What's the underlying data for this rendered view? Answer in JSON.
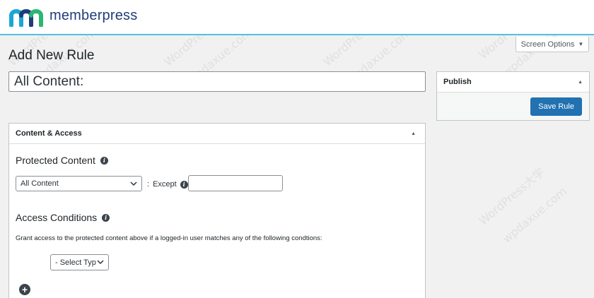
{
  "brand": {
    "name": "memberpress",
    "accent": "#4fc3d9",
    "logo_color": "#1f3d7a"
  },
  "screen_options": {
    "label": "Screen Options"
  },
  "page": {
    "title": "Add New Rule",
    "title_input_value": "All Content:"
  },
  "publish": {
    "title": "Publish",
    "save_label": "Save Rule",
    "button_color": "#2271b1"
  },
  "content_access": {
    "title": "Content & Access",
    "protected": {
      "title": "Protected Content",
      "type_select": "All Content",
      "colon": ":",
      "except_label": "Except",
      "except_value": ""
    },
    "conditions": {
      "title": "Access Conditions",
      "description": "Grant access to the protected content above if a logged-in user matches any of the following condtions:",
      "select_type": "- Select Typ"
    }
  },
  "watermark": {
    "line_a": "WordPress大学",
    "line_b": "wpdaxue.com"
  }
}
